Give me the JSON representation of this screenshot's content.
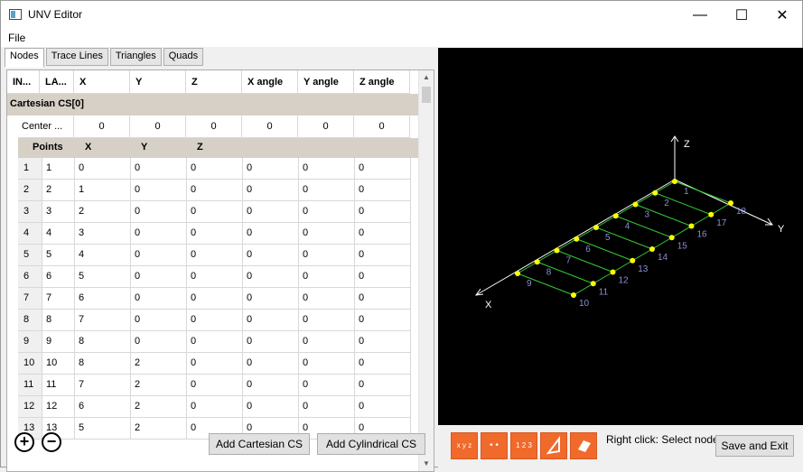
{
  "window": {
    "title": "UNV Editor",
    "minimize": "—",
    "maximize": "☐",
    "close": "✕"
  },
  "menu": {
    "file": "File"
  },
  "tabs": [
    "Nodes",
    "Trace Lines",
    "Triangles",
    "Quads"
  ],
  "table": {
    "headers": [
      "IN...",
      "LA...",
      "X",
      "Y",
      "Z",
      "X angle",
      "Y angle",
      "Z angle"
    ],
    "group": "Cartesian CS[0]",
    "center": {
      "label": "Center ...",
      "values": [
        "0",
        "0",
        "0",
        "0",
        "0",
        "0"
      ]
    },
    "points_headers": [
      "Points",
      "X",
      "Y",
      "Z"
    ],
    "rows": [
      [
        "1",
        "1",
        "0",
        "0",
        "0",
        "0",
        "0",
        "0"
      ],
      [
        "2",
        "2",
        "1",
        "0",
        "0",
        "0",
        "0",
        "0"
      ],
      [
        "3",
        "3",
        "2",
        "0",
        "0",
        "0",
        "0",
        "0"
      ],
      [
        "4",
        "4",
        "3",
        "0",
        "0",
        "0",
        "0",
        "0"
      ],
      [
        "5",
        "5",
        "4",
        "0",
        "0",
        "0",
        "0",
        "0"
      ],
      [
        "6",
        "6",
        "5",
        "0",
        "0",
        "0",
        "0",
        "0"
      ],
      [
        "7",
        "7",
        "6",
        "0",
        "0",
        "0",
        "0",
        "0"
      ],
      [
        "8",
        "8",
        "7",
        "0",
        "0",
        "0",
        "0",
        "0"
      ],
      [
        "9",
        "9",
        "8",
        "0",
        "0",
        "0",
        "0",
        "0"
      ],
      [
        "10",
        "10",
        "8",
        "2",
        "0",
        "0",
        "0",
        "0"
      ],
      [
        "11",
        "11",
        "7",
        "2",
        "0",
        "0",
        "0",
        "0"
      ],
      [
        "12",
        "12",
        "6",
        "2",
        "0",
        "0",
        "0",
        "0"
      ],
      [
        "13",
        "13",
        "5",
        "2",
        "0",
        "0",
        "0",
        "0"
      ]
    ]
  },
  "buttons": {
    "add": "+",
    "remove": "−",
    "add_cartesian": "Add Cartesian CS",
    "add_cylindrical": "Add Cylindrical CS",
    "save_exit": "Save and Exit"
  },
  "viewport": {
    "axis_labels": {
      "x": "X",
      "y": "Y",
      "z": "Z"
    },
    "node_labels": [
      "1",
      "2",
      "3",
      "4",
      "5",
      "6",
      "7",
      "8",
      "9",
      "10",
      "11",
      "12",
      "13",
      "14",
      "15",
      "16",
      "17",
      "18"
    ],
    "colors": {
      "background": "#000000",
      "mesh": "#33cc33",
      "node": "#ffff00",
      "label": "#8c8cd9",
      "axis": "#ffffff"
    }
  },
  "toolbar": {
    "icons": [
      "axes-icon",
      "nodes-icon",
      "numbering-icon",
      "triangle-icon",
      "quad-icon"
    ],
    "tool_labels": [
      "x y z",
      "• •",
      "1 2 3",
      "",
      ""
    ],
    "hint": "Right click: Select node"
  },
  "colors": {
    "accent": "#f06a2b"
  }
}
